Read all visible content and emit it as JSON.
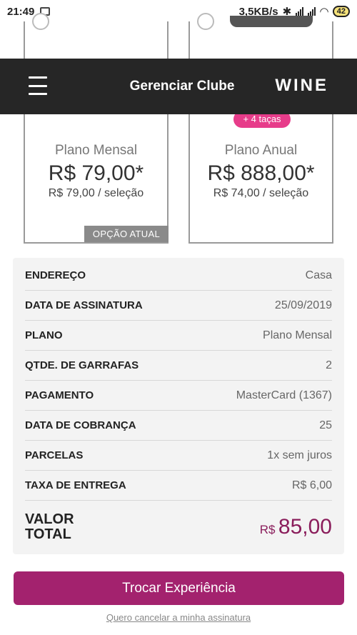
{
  "status_bar": {
    "time": "21:49",
    "net_speed": "3,5KB/s",
    "battery": "42"
  },
  "header": {
    "title": "Gerenciar Clube",
    "logo": "WINE",
    "menu_icon": "hamburger-icon"
  },
  "plans": [
    {
      "name": "Plano Mensal",
      "price": "R$ 79,00*",
      "per_selection": "R$ 79,00 / seleção",
      "badge": "OPÇÃO ATUAL"
    },
    {
      "name": "Plano Anual",
      "price": "R$ 888,00*",
      "per_selection": "R$ 74,00 / seleção",
      "promo": "+ 4 taças"
    }
  ],
  "details": {
    "rows": [
      {
        "label": "ENDEREÇO",
        "value": "Casa"
      },
      {
        "label": "DATA DE ASSINATURA",
        "value": "25/09/2019"
      },
      {
        "label": "PLANO",
        "value": "Plano Mensal"
      },
      {
        "label": "QTDE. DE GARRAFAS",
        "value": "2"
      },
      {
        "label": "PAGAMENTO",
        "value": "MasterCard (1367)"
      },
      {
        "label": "DATA DE COBRANÇA",
        "value": "25"
      },
      {
        "label": "PARCELAS",
        "value": "1x sem juros"
      },
      {
        "label": "TAXA DE ENTREGA",
        "value": "R$ 6,00"
      }
    ],
    "total_label_line1": "VALOR",
    "total_label_line2": "TOTAL",
    "total_currency": "R$",
    "total_value": "85,00"
  },
  "actions": {
    "primary_button": "Trocar Experiência",
    "cancel_link": "Quero cancelar a minha assinatura"
  },
  "colors": {
    "accent": "#a3226e",
    "header_bg": "#262626",
    "promo_pink": "#e73c8a"
  }
}
